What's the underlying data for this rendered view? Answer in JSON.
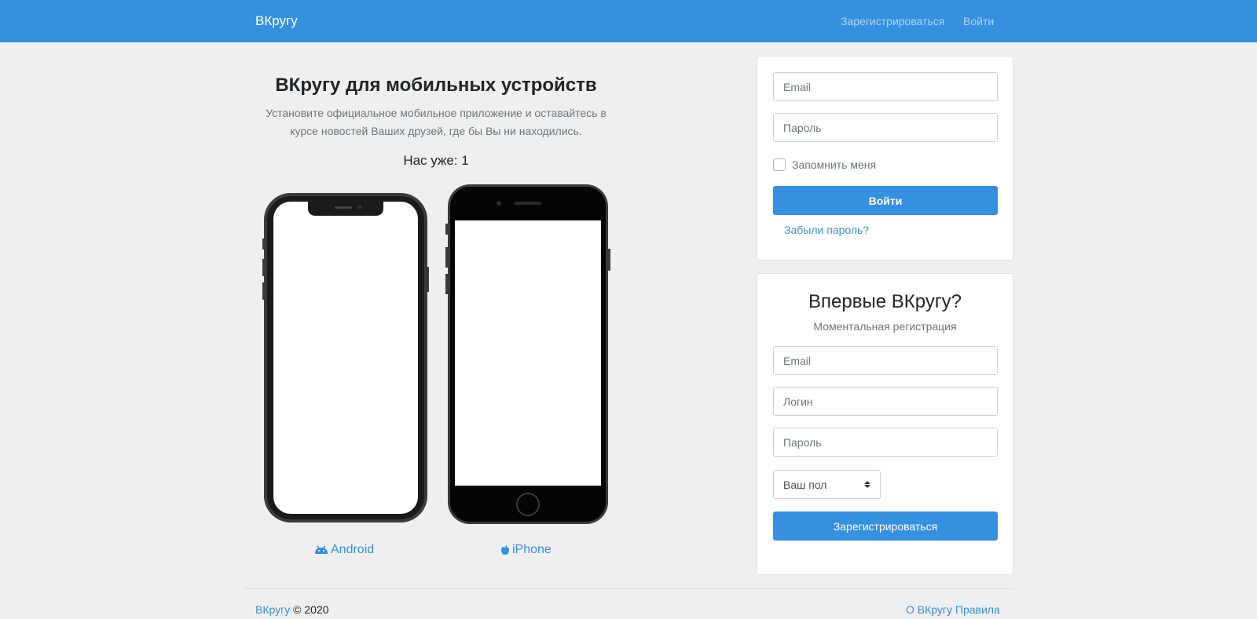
{
  "navbar": {
    "brand": "ВКругу",
    "register": "Зарегистрироваться",
    "login": "Войти",
    "color": "#3590df"
  },
  "promo": {
    "title": "ВКругу для мобильных устройств",
    "description": "Установите официальное мобильное приложение и оставайтесь в курсе новостей Ваших друзей, где бы Вы ни находились.",
    "count": "Нас уже: 1",
    "android_label": "Android",
    "android_icon": "android-icon",
    "iphone_label": "iPhone",
    "iphone_icon": "apple-icon"
  },
  "login_form": {
    "email_placeholder": "Email",
    "password_placeholder": "Пароль",
    "remember_label": "Запомнить меня",
    "submit_label": "Войти",
    "forgot_label": "Забыли пароль?"
  },
  "register_form": {
    "title": "Впервые ВКругу?",
    "subtitle": "Моментальная регистрация",
    "email_placeholder": "Email",
    "login_placeholder": "Логин",
    "password_placeholder": "Пароль",
    "gender_selected": "Ваш пол",
    "submit_label": "Зарегистрироваться"
  },
  "footer": {
    "brand_link": "ВКругу",
    "copyright": "© 2020",
    "about_link": "О ВКругу",
    "rules_link": "Правила"
  }
}
